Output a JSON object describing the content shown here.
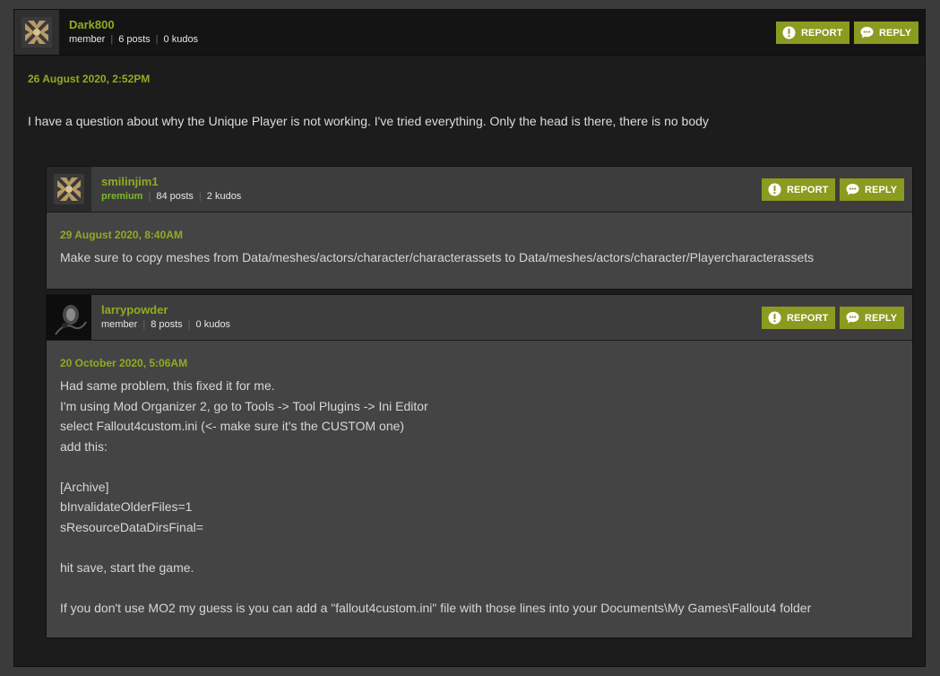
{
  "colors": {
    "accent": "#8eac22",
    "button": "#8a9b1f",
    "premium": "#7fb72a"
  },
  "icons": {
    "report": "exclamation-circle-icon",
    "reply": "speech-bubble-icon"
  },
  "buttons": {
    "report": "REPORT",
    "reply": "REPLY"
  },
  "op": {
    "author": "Dark800",
    "role": "member",
    "posts": "6 posts",
    "kudos": "0 kudos",
    "date": "26 August 2020, 2:52PM",
    "text": "I have a question about why the Unique Player is not working. I've tried everything. Only the head is there, there is no body"
  },
  "replies": [
    {
      "author": "smilinjim1",
      "role": "premium",
      "posts": "84 posts",
      "kudos": "2 kudos",
      "date": "29 August 2020, 8:40AM",
      "lines": [
        "Make sure to copy meshes from Data/meshes/actors/character/characterassets to Data/meshes/actors/character/Playercharacterassets"
      ]
    },
    {
      "author": "larrypowder",
      "role": "member",
      "posts": "8 posts",
      "kudos": "0 kudos",
      "date": "20 October 2020, 5:06AM",
      "lines": [
        "Had same problem, this fixed it for me.",
        "I'm using Mod Organizer 2, go to Tools -> Tool Plugins -> Ini Editor",
        "select Fallout4custom.ini (<- make sure it's the CUSTOM one)",
        "add this:",
        "",
        "[Archive]",
        "bInvalidateOlderFiles=1",
        "sResourceDataDirsFinal=",
        "",
        "hit save, start the game.",
        "",
        "If you don't use MO2 my guess is you can add a \"fallout4custom.ini\" file with those lines into your Documents\\My Games\\Fallout4 folder"
      ]
    }
  ]
}
